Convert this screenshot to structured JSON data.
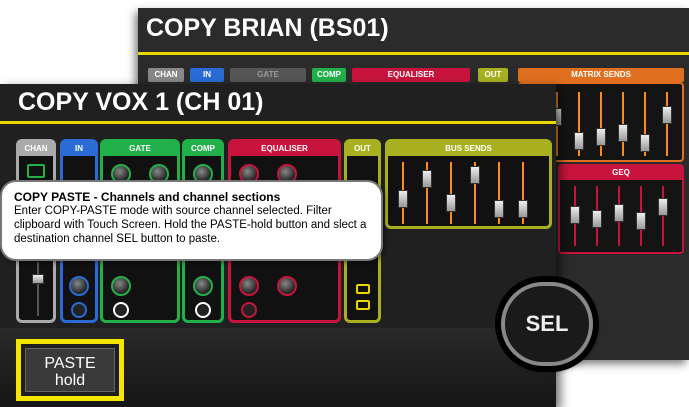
{
  "back_panel": {
    "title": "COPY BRIAN (BS01)",
    "tabs": [
      {
        "label": "CHAN",
        "color": "#888888"
      },
      {
        "label": "IN",
        "color": "#2a6bd6"
      },
      {
        "label": "GATE",
        "color": "#555555"
      },
      {
        "label": "COMP",
        "color": "#22b04a"
      },
      {
        "label": "EQUALISER",
        "color": "#c8143c"
      },
      {
        "label": "OUT",
        "color": "#a8b020"
      },
      {
        "label": "MATRIX SENDS",
        "color": "#e07020"
      }
    ],
    "geq_label": "GEQ"
  },
  "front_panel": {
    "title": "COPY VOX 1 (CH 01)",
    "sections": [
      {
        "label": "CHAN",
        "color": "#aaaaaa"
      },
      {
        "label": "IN",
        "color": "#2a6bd6"
      },
      {
        "label": "GATE",
        "color": "#22b04a"
      },
      {
        "label": "COMP",
        "color": "#22b04a"
      },
      {
        "label": "EQUALISER",
        "color": "#c8143c"
      },
      {
        "label": "OUT",
        "color": "#a8b020"
      },
      {
        "label": "BUS SENDS",
        "color": "#a8b020"
      }
    ]
  },
  "callout": {
    "heading": "COPY PASTE - Channels and channel sections",
    "body": "Enter COPY-PASTE mode with source channel selected. Filter clipboard with Touch Screen. Hold the PASTE-hold button and slect a destination channel SEL button to paste."
  },
  "sel_button": {
    "label": "SEL"
  },
  "paste_button": {
    "line1": "PASTE",
    "line2": "hold"
  },
  "colors": {
    "accent_yellow": "#e8d800",
    "panel_bg": "#202020"
  }
}
